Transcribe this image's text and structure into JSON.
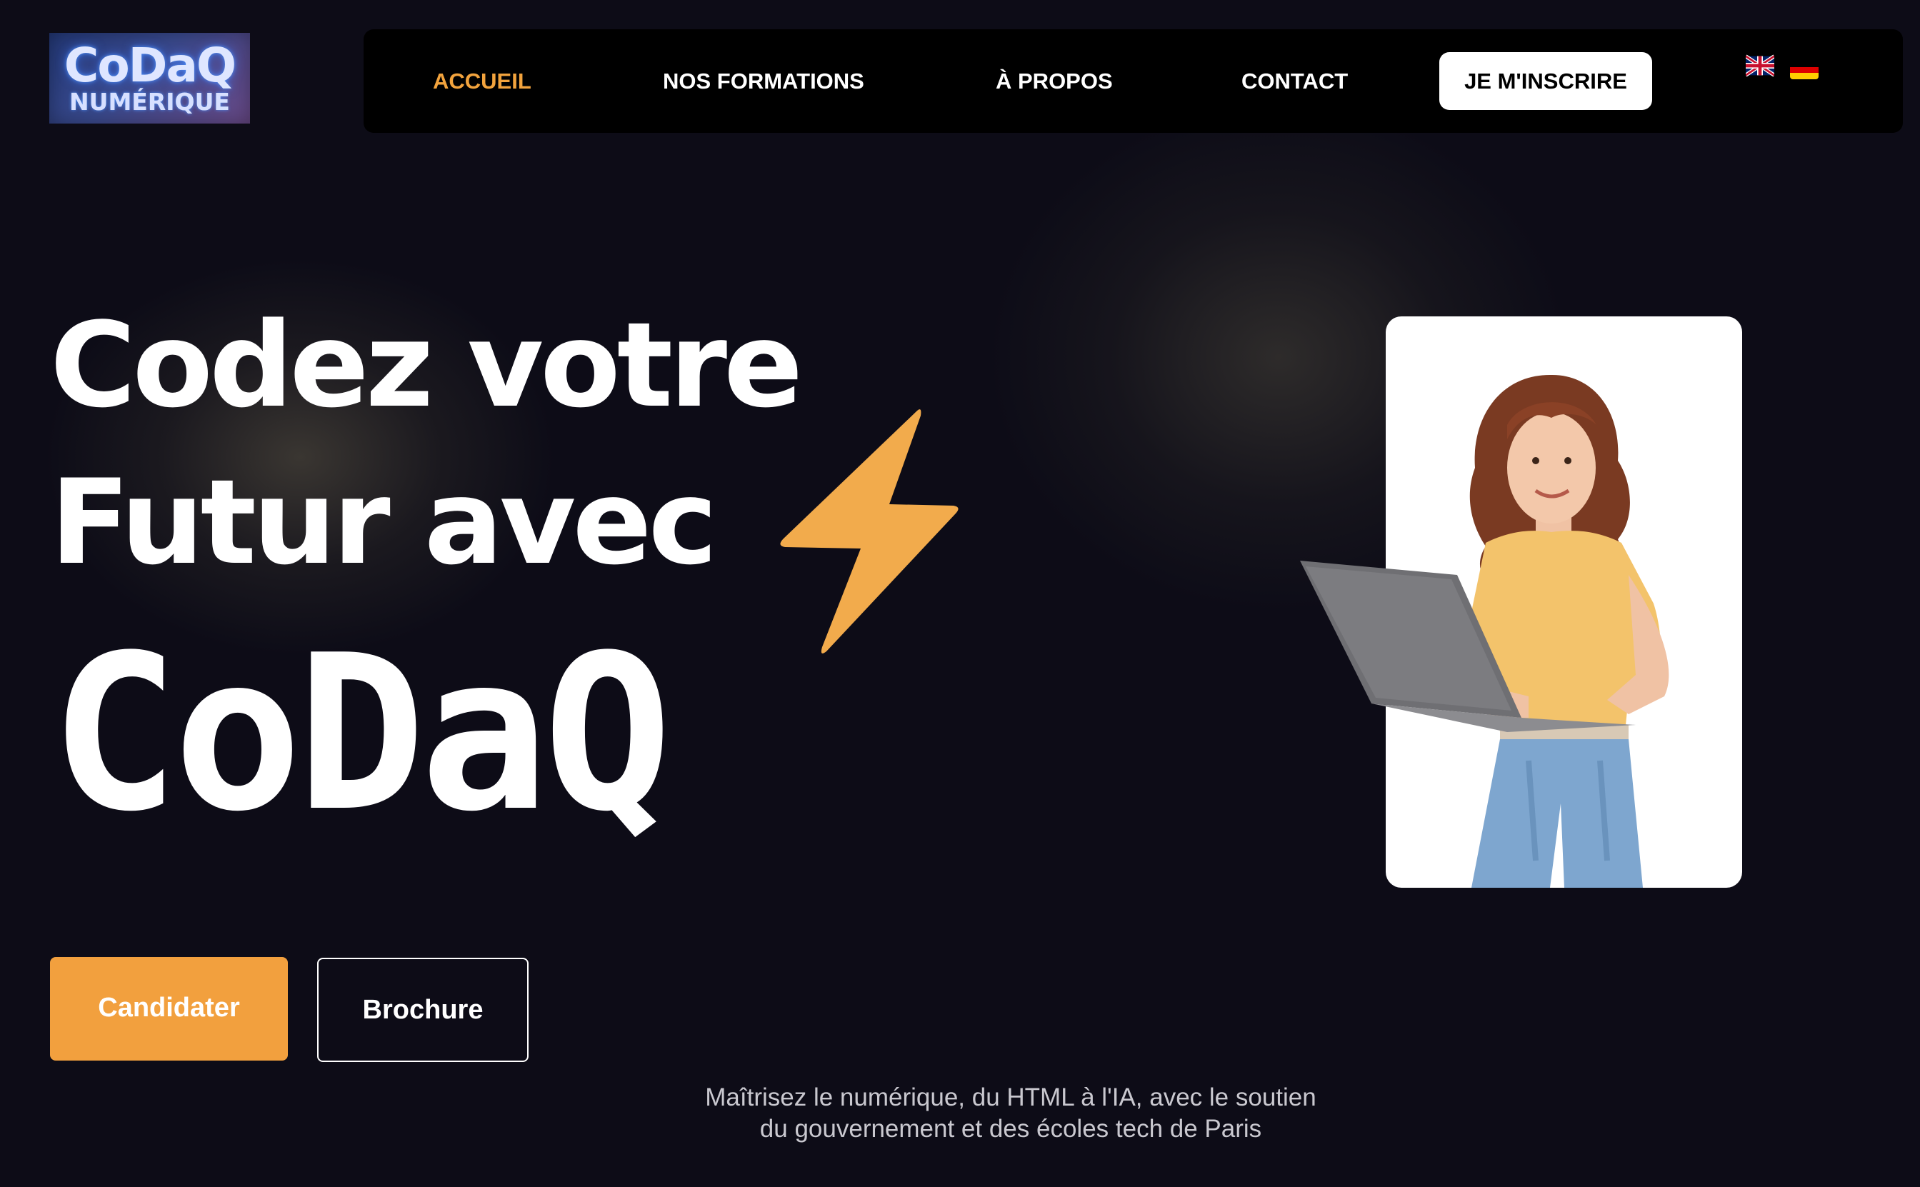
{
  "brand": {
    "logo_main": "CoDaQ",
    "logo_sub": "NUMÉRIQUE"
  },
  "nav": {
    "items": [
      {
        "label": "ACCUEIL",
        "active": true
      },
      {
        "label": "NOS FORMATIONS",
        "active": false
      },
      {
        "label": "À PROPOS",
        "active": false
      },
      {
        "label": "CONTACT",
        "active": false
      }
    ],
    "cta_label": "JE M'INSCRIRE",
    "languages": [
      {
        "icon": "uk-flag-icon"
      },
      {
        "icon": "germany-flag-icon"
      }
    ]
  },
  "hero": {
    "line1": "Codez votre",
    "line2": "Futur avec",
    "line3": "CoDaQ",
    "bolt_icon": "lightning-bolt-icon"
  },
  "actions": {
    "primary_label": "Candidater",
    "secondary_label": "Brochure"
  },
  "tagline": {
    "line1": "Maîtrisez le numérique, du HTML à l'IA, avec le soutien",
    "line2": "du gouvernement et des écoles tech de Paris"
  },
  "colors": {
    "background": "#0d0c17",
    "accent": "#f2a33d",
    "nav_background": "#000000",
    "text": "#ffffff"
  }
}
